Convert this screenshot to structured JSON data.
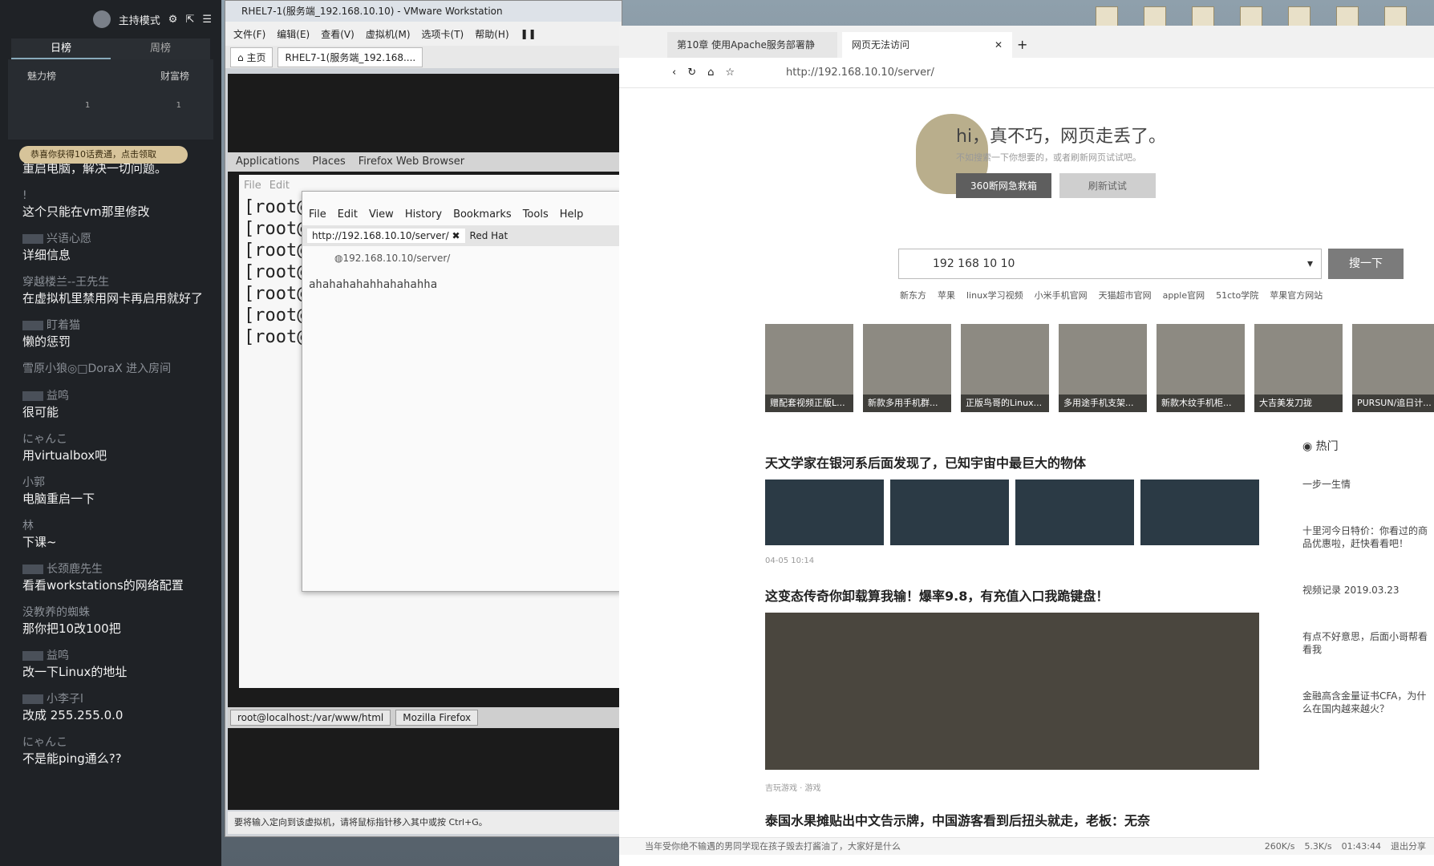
{
  "chat": {
    "mode": "主持模式",
    "tabs": [
      "日榜",
      "周榜"
    ],
    "ranks": [
      "魅力榜",
      "财富榜"
    ],
    "rank_counts": [
      "1",
      "1"
    ],
    "reward_pill": "恭喜你获得10话费通，点击领取",
    "messages": [
      {
        "name": "",
        "text": "重启电脑，解决一切问题。"
      },
      {
        "name": "!",
        "text": "这个只能在vm那里修改"
      },
      {
        "name": "兴语心愿",
        "text": "详细信息"
      },
      {
        "name": "穿越楼兰--王先生",
        "text": "在虚拟机里禁用网卡再启用就好了"
      },
      {
        "name": "盯着猫",
        "text": "懒的惩罚"
      },
      {
        "name": "",
        "text": "雪原小狼◎□DoraX 进入房间"
      },
      {
        "name": "益鸣",
        "text": "很可能"
      },
      {
        "name": "にゃんこ",
        "text": "用virtualbox吧"
      },
      {
        "name": "小郭",
        "text": "电脑重启一下"
      },
      {
        "name": "林",
        "text": "下课~"
      },
      {
        "name": "长颈鹿先生",
        "text": "看看workstations的网络配置"
      },
      {
        "name": "没教养的蜘蛛",
        "text": "那你把10改100把"
      },
      {
        "name": "益鸣",
        "text": "改一下Linux的地址"
      },
      {
        "name": "小李子l",
        "text": "改成 255.255.0.0"
      },
      {
        "name": "にゃんこ",
        "text": "不是能ping通么??"
      }
    ]
  },
  "vmware": {
    "title": "RHEL7-1(服务端_192.168.10.10) - VMware Workstation",
    "menu": [
      "文件(F)",
      "编辑(E)",
      "查看(V)",
      "虚拟机(M)",
      "选项卡(T)",
      "帮助(H)"
    ],
    "tabs": [
      "主页",
      "RHEL7-1(服务端_192.168...."
    ],
    "gnome_bar": [
      "Applications",
      "Places",
      "Firefox Web Browser"
    ],
    "terminal_prompts": [
      "[root@",
      "[root@",
      "[root@",
      "[root@",
      "[root@",
      "[root@",
      "[root@"
    ],
    "terminal_menu": [
      "File",
      "Edit"
    ],
    "firefox": {
      "menu": [
        "File",
        "Edit",
        "View",
        "History",
        "Bookmarks",
        "Tools",
        "Help"
      ],
      "tabs": [
        "http://192.168.10.10/server/",
        "Red Hat"
      ],
      "url": "192.168.10.10/server/",
      "content": "ahahahahahhahahahha"
    },
    "taskbar": [
      "root@localhost:/var/www/html",
      "Mozilla Firefox"
    ],
    "status": "要将输入定向到该虚拟机，请将鼠标指针移入其中或按 Ctrl+G。"
  },
  "browser": {
    "tabs": [
      "第10章 使用Apache服务部署静",
      "网页无法访问"
    ],
    "url": "http://192.168.10.10/server/",
    "error_title": "hi，真不巧，网页走丢了。",
    "error_sub": "不如搜索一下你想要的，或者刷新网页试试吧。",
    "btn_rescue": "360断网急救箱",
    "btn_refresh": "刷新试试",
    "search_value": "192 168 10 10",
    "search_button": "搜一下",
    "links": [
      "新东方",
      "苹果",
      "linux学习视频",
      "小米手机官网",
      "天猫超市官网",
      "apple官网",
      "51cto学院",
      "苹果官方网站"
    ],
    "products": [
      "赠配套视频正版L...",
      "新款多用手机群...",
      "正版鸟哥的Linux...",
      "多用途手机支架...",
      "新款木纹手机柜...",
      "大吉美发刀拢",
      "PURSUN/追日计..."
    ],
    "hot_label": "热门",
    "hot_items": [
      "一步一生情",
      "十里河今日特价：你看过的商品优惠啦，赶快看看吧！",
      "视频记录 2019.03.23",
      "有点不好意思，后面小哥帮看看我",
      "金融高含金量证书CFA，为什么在国内越来越火？"
    ],
    "news": [
      {
        "title": "天文学家在银河系后面发现了，已知宇宙中最巨大的物体",
        "meta": "04-05 10:14"
      },
      {
        "title": "这变态传奇你卸载算我输！爆率9.8，有充值入口我跪键盘！",
        "meta": "吉玩游戏 · 游戏"
      },
      {
        "title": "泰国水果摊贴出中文告示牌，中国游客看到后扭头就走，老板：无奈",
        "meta": ""
      }
    ],
    "status_left": "当年受你绝不输遇的男同学现在孩子毁去打酱油了，大家好是什么",
    "clock": "01:43:44",
    "logout": "退出分享",
    "net_up": "260K/s",
    "net_down": "5.3K/s"
  }
}
